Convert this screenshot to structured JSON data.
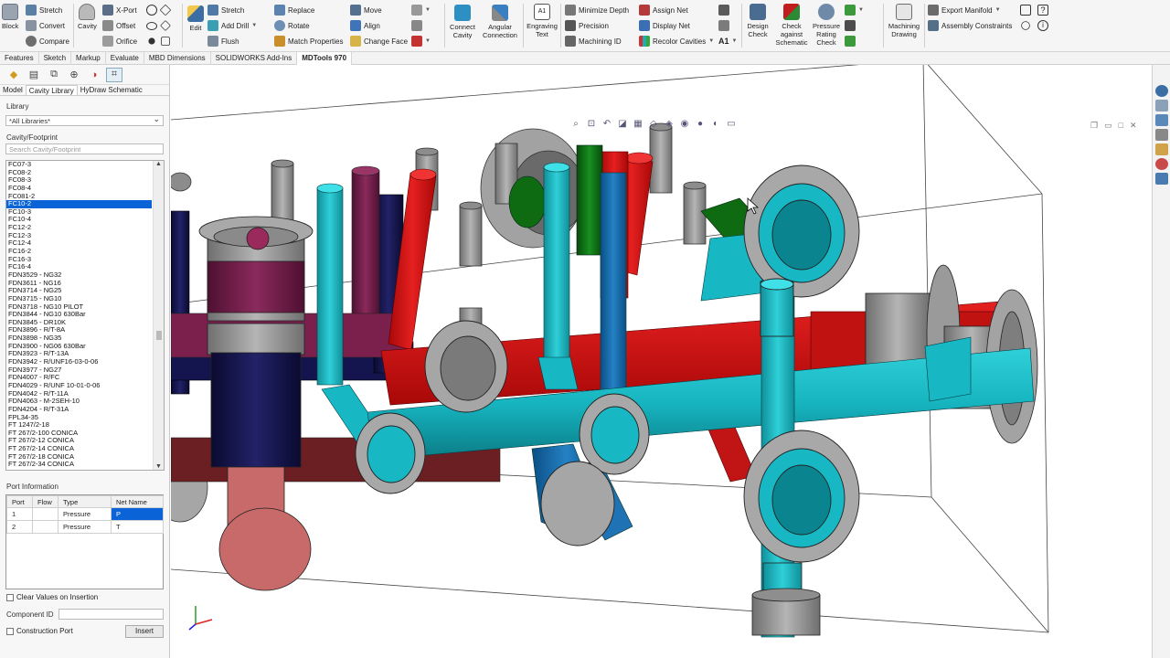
{
  "ribbon": {
    "block": "Block",
    "stretch1": "Stretch",
    "convert": "Convert",
    "compare": "Compare",
    "cavity": "Cavity",
    "xport": "X-Port",
    "offset": "Offset",
    "orifice": "Orifice",
    "edit": "Edit",
    "stretch2": "Stretch",
    "add_drill": "Add Drill",
    "flush": "Flush",
    "replace": "Replace",
    "rotate": "Rotate",
    "match_properties": "Match Properties",
    "move": "Move",
    "align": "Align",
    "change_face": "Change Face",
    "connect_cavity": "Connect Cavity",
    "angular_connection": "Angular Connection",
    "engraving_text": "Engraving Text",
    "engrave_icon_text": "A1",
    "minimize_depth": "Minimize Depth",
    "precision": "Precision",
    "machining_id": "Machining ID",
    "assign_net": "Assign Net",
    "display_net": "Display Net",
    "recolor_cavities": "Recolor Cavities",
    "a1_label": "A1",
    "design_check": "Design Check",
    "check_against_schematic": "Check against Schematic",
    "pressure_rating_check": "Pressure Rating Check",
    "machining_drawing": "Machining Drawing",
    "export_manifold": "Export Manifold",
    "assembly_constraints": "Assembly Constraints"
  },
  "command_tabs": [
    "Features",
    "Sketch",
    "Markup",
    "Evaluate",
    "MBD Dimensions",
    "SOLIDWORKS Add-Ins",
    "MDTools 970"
  ],
  "active_command_tab": "MDTools 970",
  "panel": {
    "tabs": [
      "Model",
      "Cavity Library",
      "HyDraw Schematic"
    ],
    "active_tab": "Cavity Library",
    "library_label": "Library",
    "library_value": "*All Libraries*",
    "cavity_label": "Cavity/Footprint",
    "search_placeholder": "Search Cavity/Footprint",
    "cavities": [
      "FC07-3",
      "FC08-2",
      "FC08-3",
      "FC08-4",
      "FC081-2",
      "FC10-2",
      "FC10-3",
      "FC10-4",
      "FC12-2",
      "FC12-3",
      "FC12-4",
      "FC16-2",
      "FC16-3",
      "FC16-4",
      "FDN3529 - NG32",
      "FDN3611 - NG16",
      "FDN3714 - NG25",
      "FDN3715 - NG10",
      "FDN3718 - NG10 PILOT",
      "FDN3844 - NG10 630Bar",
      "FDN3845 - DR10K",
      "FDN3896 - R/T-8A",
      "FDN3898 - NG35",
      "FDN3900 - NG06 630Bar",
      "FDN3923 - R/T-13A",
      "FDN3942 - R/UNF16-03-0-06",
      "FDN3977 - NG27",
      "FDN4007 - R/FC",
      "FDN4029 - R/UNF 10-01-0-06",
      "FDN4042 - R/T-11A",
      "FDN4063 - M-2SEH-10",
      "FDN4204 - R/T-31A",
      "FPL34-35",
      "FT 1247/2-18",
      "FT 267/2-100 CONICA",
      "FT 267/2-12 CONICA",
      "FT 267/2-14 CONICA",
      "FT 267/2-18 CONICA",
      "FT 267/2-34 CONICA"
    ],
    "selected_cavity": "FC10-2",
    "port_info_label": "Port Information",
    "port_columns": [
      "Port",
      "Flow",
      "Type",
      "Net Name"
    ],
    "ports": [
      {
        "port": "1",
        "flow": "",
        "type": "Pressure",
        "net": "P"
      },
      {
        "port": "2",
        "flow": "",
        "type": "Pressure",
        "net": "T"
      }
    ],
    "clear_values_label": "Clear Values on Insertion",
    "component_id_label": "Component ID",
    "component_id_value": "",
    "construction_port_label": "Construction Port",
    "insert_label": "Insert"
  },
  "colors": {
    "accent_blue": "#0a64d7",
    "cyan_passage": "#17b7c4",
    "red_passage": "#d40f0f",
    "navy_passage": "#12124a",
    "maroon_passage": "#6a1a45",
    "green_passage": "#0f6b12",
    "gray_cavity": "#9a9a9a"
  }
}
